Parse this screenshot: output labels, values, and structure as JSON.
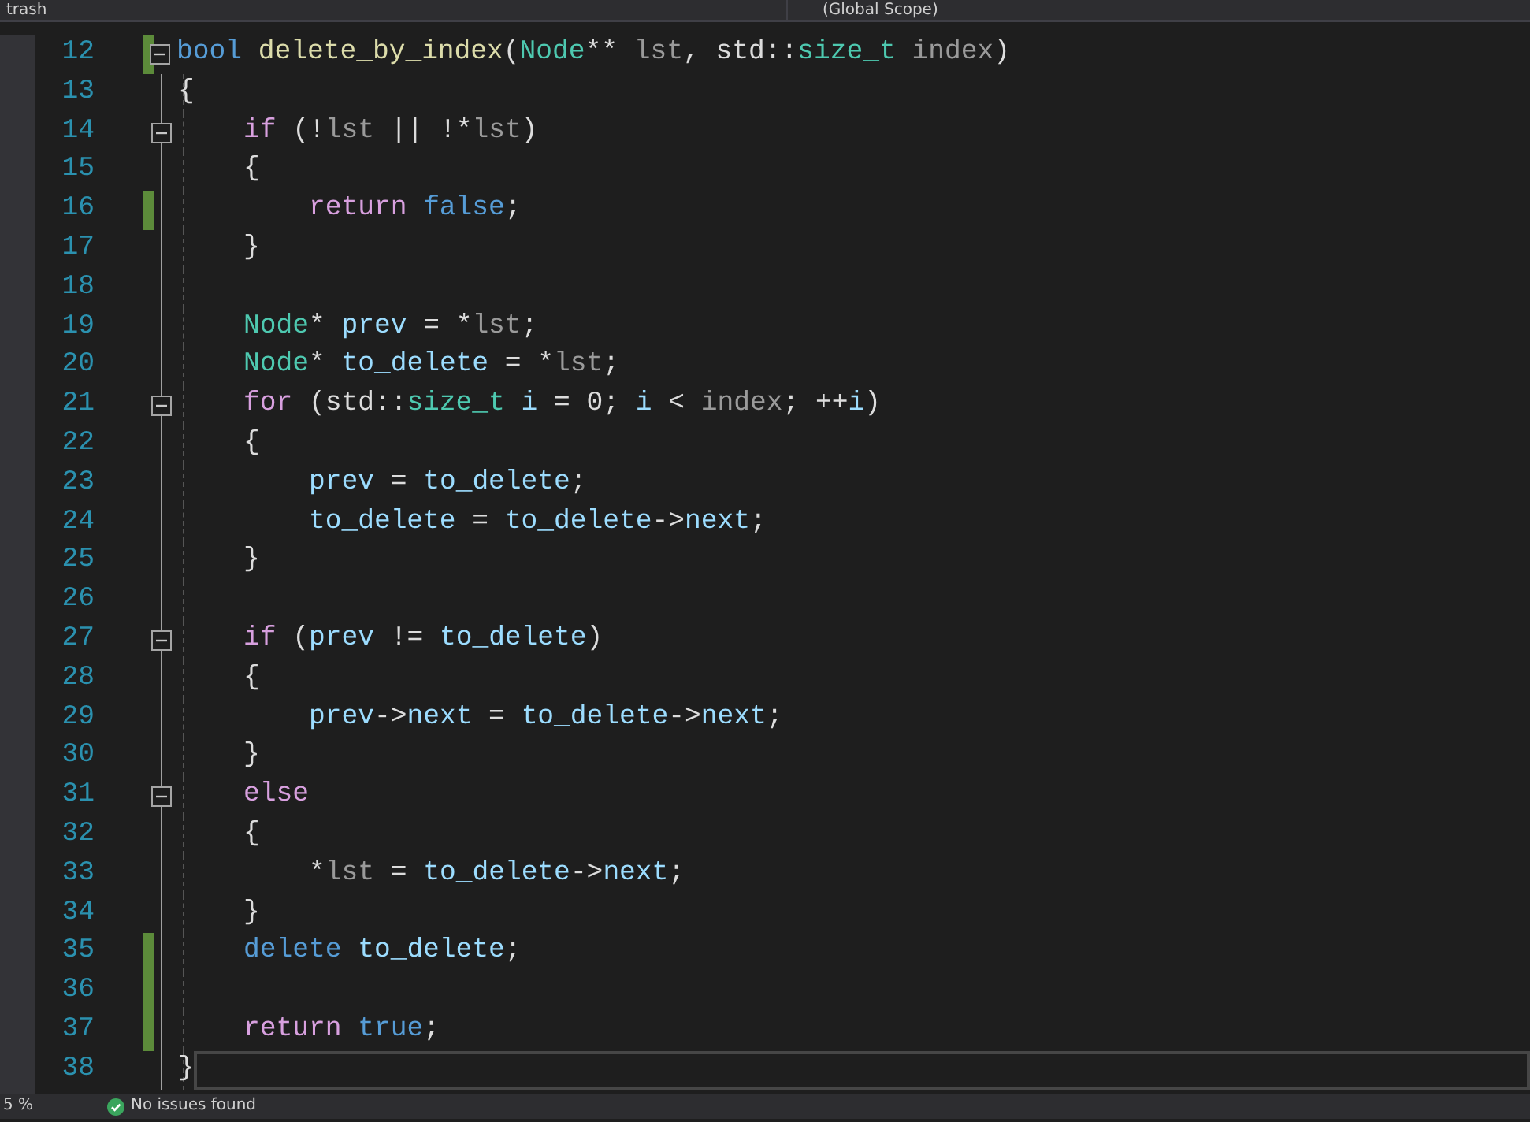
{
  "top_bar": {
    "project": "trash",
    "scope": "(Global Scope)"
  },
  "lines": [
    {
      "number": "12",
      "changed": true,
      "fold": true,
      "current": false,
      "tokens": [
        {
          "kind": "keyword",
          "text": "bool "
        },
        {
          "kind": "function",
          "text": "delete_by_index"
        },
        {
          "kind": "plain",
          "text": "("
        },
        {
          "kind": "type",
          "text": "Node"
        },
        {
          "kind": "plain",
          "text": "** "
        },
        {
          "kind": "param",
          "text": "lst"
        },
        {
          "kind": "plain",
          "text": ", std::"
        },
        {
          "kind": "type",
          "text": "size_t "
        },
        {
          "kind": "param",
          "text": "index"
        },
        {
          "kind": "plain",
          "text": ")"
        }
      ]
    },
    {
      "number": "13",
      "changed": false,
      "fold": false,
      "current": false,
      "tokens": [
        {
          "kind": "plain",
          "text": "{"
        }
      ]
    },
    {
      "number": "14",
      "changed": false,
      "fold": true,
      "current": false,
      "tokens": [
        {
          "kind": "control",
          "text": "    if"
        },
        {
          "kind": "plain",
          "text": " (!"
        },
        {
          "kind": "param",
          "text": "lst"
        },
        {
          "kind": "plain",
          "text": " || !*"
        },
        {
          "kind": "param",
          "text": "lst"
        },
        {
          "kind": "plain",
          "text": ")"
        }
      ]
    },
    {
      "number": "15",
      "changed": false,
      "fold": false,
      "current": false,
      "tokens": [
        {
          "kind": "plain",
          "text": "    {"
        }
      ]
    },
    {
      "number": "16",
      "changed": true,
      "fold": false,
      "current": false,
      "tokens": [
        {
          "kind": "control",
          "text": "        return "
        },
        {
          "kind": "keyword",
          "text": "false"
        },
        {
          "kind": "plain",
          "text": ";"
        }
      ]
    },
    {
      "number": "17",
      "changed": false,
      "fold": false,
      "current": false,
      "tokens": [
        {
          "kind": "plain",
          "text": "    }"
        }
      ]
    },
    {
      "number": "18",
      "changed": false,
      "fold": false,
      "current": false
    },
    {
      "number": "19",
      "changed": false,
      "fold": false,
      "current": false,
      "tokens": [
        {
          "kind": "type",
          "text": "    Node"
        },
        {
          "kind": "plain",
          "text": "* "
        },
        {
          "kind": "local",
          "text": "prev"
        },
        {
          "kind": "plain",
          "text": " = *"
        },
        {
          "kind": "param",
          "text": "lst"
        },
        {
          "kind": "plain",
          "text": ";"
        }
      ]
    },
    {
      "number": "20",
      "changed": false,
      "fold": false,
      "current": false,
      "tokens": [
        {
          "kind": "type",
          "text": "    Node"
        },
        {
          "kind": "plain",
          "text": "* "
        },
        {
          "kind": "local",
          "text": "to_delete"
        },
        {
          "kind": "plain",
          "text": " = *"
        },
        {
          "kind": "param",
          "text": "lst"
        },
        {
          "kind": "plain",
          "text": ";"
        }
      ]
    },
    {
      "number": "21",
      "changed": false,
      "fold": true,
      "current": false,
      "tokens": [
        {
          "kind": "control",
          "text": "    for"
        },
        {
          "kind": "plain",
          "text": " (std::"
        },
        {
          "kind": "type",
          "text": "size_t "
        },
        {
          "kind": "local",
          "text": "i"
        },
        {
          "kind": "plain",
          "text": " = 0; "
        },
        {
          "kind": "local",
          "text": "i"
        },
        {
          "kind": "plain",
          "text": " < "
        },
        {
          "kind": "param",
          "text": "index"
        },
        {
          "kind": "plain",
          "text": "; ++"
        },
        {
          "kind": "local",
          "text": "i"
        },
        {
          "kind": "plain",
          "text": ")"
        }
      ]
    },
    {
      "number": "22",
      "changed": false,
      "fold": false,
      "current": false,
      "tokens": [
        {
          "kind": "plain",
          "text": "    {"
        }
      ]
    },
    {
      "number": "23",
      "changed": false,
      "fold": false,
      "current": false,
      "tokens": [
        {
          "kind": "local",
          "text": "        prev"
        },
        {
          "kind": "plain",
          "text": " = "
        },
        {
          "kind": "local",
          "text": "to_delete"
        },
        {
          "kind": "plain",
          "text": ";"
        }
      ]
    },
    {
      "number": "24",
      "changed": false,
      "fold": false,
      "current": false,
      "tokens": [
        {
          "kind": "local",
          "text": "        to_delete"
        },
        {
          "kind": "plain",
          "text": " = "
        },
        {
          "kind": "local",
          "text": "to_delete"
        },
        {
          "kind": "plain",
          "text": "->"
        },
        {
          "kind": "local",
          "text": "next"
        },
        {
          "kind": "plain",
          "text": ";"
        }
      ]
    },
    {
      "number": "25",
      "changed": false,
      "fold": false,
      "current": false,
      "tokens": [
        {
          "kind": "plain",
          "text": "    }"
        }
      ]
    },
    {
      "number": "26",
      "changed": false,
      "fold": false,
      "current": false
    },
    {
      "number": "27",
      "changed": false,
      "fold": true,
      "current": false,
      "tokens": [
        {
          "kind": "control",
          "text": "    if"
        },
        {
          "kind": "plain",
          "text": " ("
        },
        {
          "kind": "local",
          "text": "prev"
        },
        {
          "kind": "plain",
          "text": " != "
        },
        {
          "kind": "local",
          "text": "to_delete"
        },
        {
          "kind": "plain",
          "text": ")"
        }
      ]
    },
    {
      "number": "28",
      "changed": false,
      "fold": false,
      "current": false,
      "tokens": [
        {
          "kind": "plain",
          "text": "    {"
        }
      ]
    },
    {
      "number": "29",
      "changed": false,
      "fold": false,
      "current": false,
      "tokens": [
        {
          "kind": "local",
          "text": "        prev"
        },
        {
          "kind": "plain",
          "text": "->"
        },
        {
          "kind": "local",
          "text": "next"
        },
        {
          "kind": "plain",
          "text": " = "
        },
        {
          "kind": "local",
          "text": "to_delete"
        },
        {
          "kind": "plain",
          "text": "->"
        },
        {
          "kind": "local",
          "text": "next"
        },
        {
          "kind": "plain",
          "text": ";"
        }
      ]
    },
    {
      "number": "30",
      "changed": false,
      "fold": false,
      "current": false,
      "tokens": [
        {
          "kind": "plain",
          "text": "    }"
        }
      ]
    },
    {
      "number": "31",
      "changed": false,
      "fold": true,
      "current": false,
      "tokens": [
        {
          "kind": "control",
          "text": "    else"
        }
      ]
    },
    {
      "number": "32",
      "changed": false,
      "fold": false,
      "current": false,
      "tokens": [
        {
          "kind": "plain",
          "text": "    {"
        }
      ]
    },
    {
      "number": "33",
      "changed": false,
      "fold": false,
      "current": false,
      "tokens": [
        {
          "kind": "plain",
          "text": "        *"
        },
        {
          "kind": "param",
          "text": "lst"
        },
        {
          "kind": "plain",
          "text": " = "
        },
        {
          "kind": "local",
          "text": "to_delete"
        },
        {
          "kind": "plain",
          "text": "->"
        },
        {
          "kind": "local",
          "text": "next"
        },
        {
          "kind": "plain",
          "text": ";"
        }
      ]
    },
    {
      "number": "34",
      "changed": false,
      "fold": false,
      "current": false,
      "tokens": [
        {
          "kind": "plain",
          "text": "    }"
        }
      ]
    },
    {
      "number": "35",
      "changed": true,
      "fold": false,
      "current": false,
      "tokens": [
        {
          "kind": "keyword",
          "text": "    delete "
        },
        {
          "kind": "local",
          "text": "to_delete"
        },
        {
          "kind": "plain",
          "text": ";"
        }
      ]
    },
    {
      "number": "36",
      "changed": true,
      "fold": false,
      "current": false
    },
    {
      "number": "37",
      "changed": true,
      "fold": false,
      "current": false,
      "tokens": [
        {
          "kind": "control",
          "text": "    return "
        },
        {
          "kind": "keyword",
          "text": "true"
        },
        {
          "kind": "plain",
          "text": ";"
        }
      ]
    },
    {
      "number": "38",
      "changed": false,
      "fold": false,
      "current": true,
      "tokens": [
        {
          "kind": "plain",
          "text": "}"
        }
      ]
    }
  ],
  "status_bar": {
    "zoom": "5 %",
    "issues": "No issues found"
  }
}
